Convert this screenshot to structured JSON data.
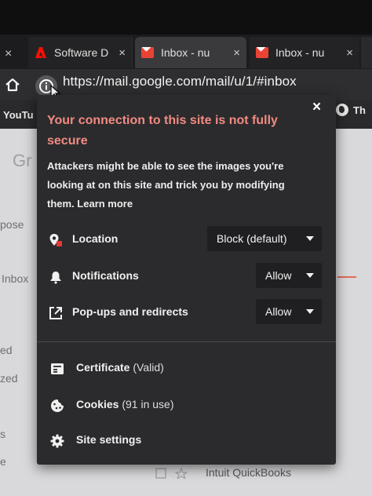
{
  "browser": {
    "tabs": [
      {
        "title": "Software D",
        "icon": "adobe-icon"
      },
      {
        "title": "Inbox - nu",
        "icon": "gmail-icon"
      },
      {
        "title": "Inbox - nu",
        "icon": "gmail-icon"
      }
    ],
    "tab_close_glyph": "×",
    "address_bar": {
      "url": "https://mail.google.com/mail/u/1/#inbox"
    },
    "bookmarks": {
      "youtube": "YouTu",
      "right_item": "Th"
    }
  },
  "background_page": {
    "logo_fragment": "Gr",
    "sidebar_fragments": [
      "pose",
      "Inbox",
      "ed",
      "zed",
      "s",
      "e"
    ],
    "email_row": "Intuit QuickBooks"
  },
  "site_info_popup": {
    "close_glyph": "×",
    "heading": "Your connection to this site is not fully secure",
    "description": "Attackers might be able to see the images you're looking at on this site and trick you by modifying them.",
    "learn_more": "Learn more",
    "permissions": [
      {
        "label": "Location",
        "value": "Block (default)",
        "icon": "location-icon"
      },
      {
        "label": "Notifications",
        "value": "Allow",
        "icon": "bell-icon"
      },
      {
        "label": "Pop-ups and redirects",
        "value": "Allow",
        "icon": "popup-icon"
      }
    ],
    "links": [
      {
        "label": "Certificate",
        "detail": "(Valid)",
        "icon": "certificate-icon"
      },
      {
        "label": "Cookies",
        "detail": "(91 in use)",
        "icon": "cookie-icon"
      },
      {
        "label": "Site settings",
        "detail": "",
        "icon": "gear-icon"
      }
    ]
  },
  "colors": {
    "warning_heading": "#f28b82",
    "popup_background": "#2b2b2d",
    "gmail_red": "#ea4335",
    "adobe_red": "#fa0f00"
  }
}
